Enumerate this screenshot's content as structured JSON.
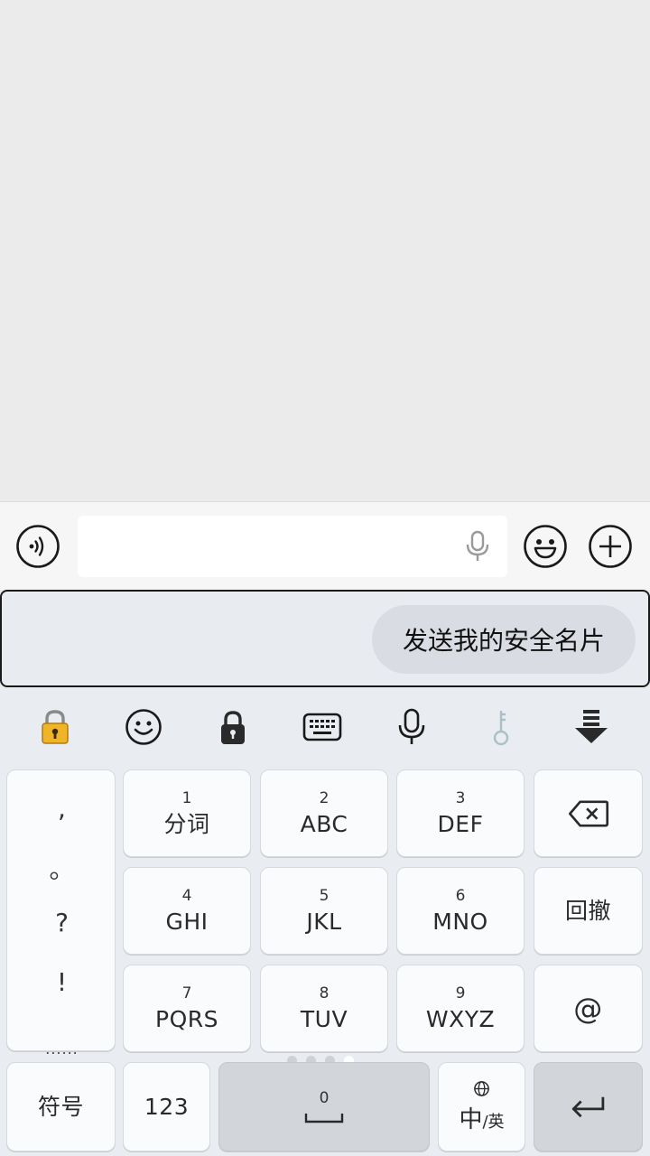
{
  "input_bar": {
    "voice_icon": "voice-wave-icon",
    "placeholder": "",
    "mic_icon": "microphone-icon",
    "emoji_icon": "smiley-icon",
    "plus_icon": "plus-circle-icon"
  },
  "suggestion": {
    "text": "发送我的安全名片"
  },
  "toolbar": {
    "icons": [
      "padlock-gold-icon",
      "smiley-icon",
      "padlock-icon",
      "keyboard-icon",
      "microphone-icon",
      "key-icon",
      "collapse-keyboard-icon"
    ]
  },
  "keyboard": {
    "punctuation": [
      ",",
      "。",
      "?",
      "!"
    ],
    "punct_more": "......",
    "keys": [
      {
        "num": "1",
        "label": "分词"
      },
      {
        "num": "2",
        "label": "ABC"
      },
      {
        "num": "3",
        "label": "DEF"
      },
      {
        "num": "4",
        "label": "GHI"
      },
      {
        "num": "5",
        "label": "JKL"
      },
      {
        "num": "6",
        "label": "MNO"
      },
      {
        "num": "7",
        "label": "PQRS"
      },
      {
        "num": "8",
        "label": "TUV"
      },
      {
        "num": "9",
        "label": "WXYZ"
      }
    ],
    "backspace_icon": "backspace-icon",
    "undo_label": "回撤",
    "at_label": "@",
    "symbols_label": "符号",
    "numbers_label": "123",
    "space_num": "0",
    "lang_big": "中",
    "lang_small": "/英",
    "enter_icon": "enter-icon"
  },
  "colors": {
    "chat_bg": "#ebebeb",
    "keyboard_bg": "#e9ecf0",
    "key_bg": "#fafbfc",
    "key_gray": "#d2d5d9",
    "lock_gold": "#f0b429"
  }
}
